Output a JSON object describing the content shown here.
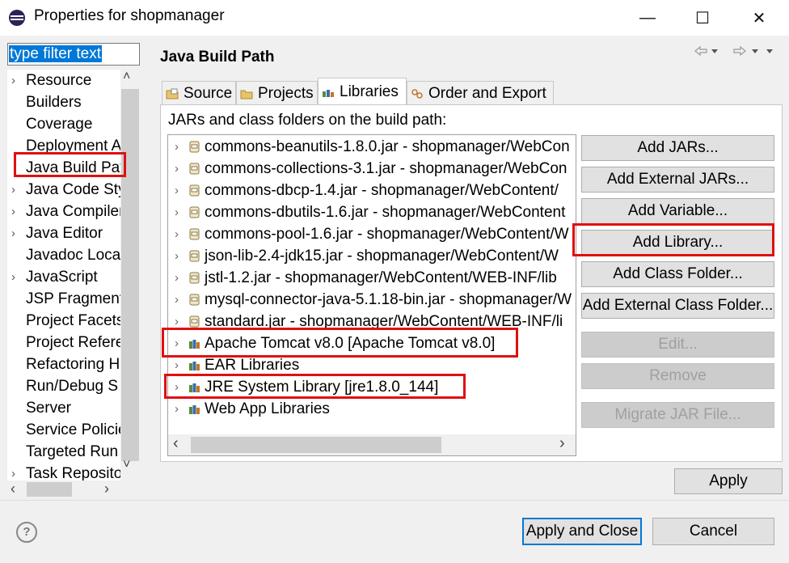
{
  "window": {
    "title": "Properties for shopmanager",
    "minimize_glyph": "—",
    "maximize_glyph": "☐",
    "close_glyph": "✕"
  },
  "filter": {
    "text": "type filter text"
  },
  "sidebar": {
    "items": [
      {
        "label": "Resource",
        "arrow": "›"
      },
      {
        "label": "Builders",
        "arrow": ""
      },
      {
        "label": "Coverage",
        "arrow": ""
      },
      {
        "label": "Deployment A",
        "arrow": ""
      },
      {
        "label": "Java Build Pat",
        "arrow": ""
      },
      {
        "label": "Java Code Sty",
        "arrow": "›"
      },
      {
        "label": "Java Compiler",
        "arrow": "›"
      },
      {
        "label": "Java Editor",
        "arrow": "›"
      },
      {
        "label": "Javadoc Locat",
        "arrow": ""
      },
      {
        "label": "JavaScript",
        "arrow": "›"
      },
      {
        "label": "JSP Fragment",
        "arrow": ""
      },
      {
        "label": "Project Facets",
        "arrow": ""
      },
      {
        "label": "Project Refere",
        "arrow": ""
      },
      {
        "label": "Refactoring H",
        "arrow": ""
      },
      {
        "label": "Run/Debug S",
        "arrow": ""
      },
      {
        "label": "Server",
        "arrow": ""
      },
      {
        "label": "Service Policie",
        "arrow": ""
      },
      {
        "label": "Targeted Run",
        "arrow": ""
      },
      {
        "label": "Task Reposito",
        "arrow": "›"
      }
    ]
  },
  "page": {
    "title": "Java Build Path"
  },
  "tabs": [
    {
      "label": "Source"
    },
    {
      "label": "Projects"
    },
    {
      "label": "Libraries"
    },
    {
      "label": "Order and Export"
    }
  ],
  "panel": {
    "label": "JARs and class folders on the build path:"
  },
  "entries": [
    {
      "label": "commons-beanutils-1.8.0.jar - shopmanager/WebCon",
      "kind": "jar"
    },
    {
      "label": "commons-collections-3.1.jar - shopmanager/WebCon",
      "kind": "jar"
    },
    {
      "label": "commons-dbcp-1.4.jar - shopmanager/WebContent/",
      "kind": "jar"
    },
    {
      "label": "commons-dbutils-1.6.jar - shopmanager/WebContent",
      "kind": "jar"
    },
    {
      "label": "commons-pool-1.6.jar - shopmanager/WebContent/W",
      "kind": "jar"
    },
    {
      "label": "json-lib-2.4-jdk15.jar - shopmanager/WebContent/W",
      "kind": "jar"
    },
    {
      "label": "jstl-1.2.jar - shopmanager/WebContent/WEB-INF/lib",
      "kind": "jar"
    },
    {
      "label": "mysql-connector-java-5.1.18-bin.jar - shopmanager/W",
      "kind": "jar"
    },
    {
      "label": "standard.jar - shopmanager/WebContent/WEB-INF/li",
      "kind": "jar"
    },
    {
      "label": "Apache Tomcat v8.0 [Apache Tomcat v8.0]",
      "kind": "lib"
    },
    {
      "label": "EAR Libraries",
      "kind": "lib"
    },
    {
      "label": "JRE System Library [jre1.8.0_144]",
      "kind": "lib"
    },
    {
      "label": "Web App Libraries",
      "kind": "lib"
    }
  ],
  "buttons": {
    "add_jars": "Add JARs...",
    "add_external_jars": "Add External JARs...",
    "add_variable": "Add Variable...",
    "add_library": "Add Library...",
    "add_class_folder": "Add Class Folder...",
    "add_external_class_folder": "Add External Class Folder...",
    "edit": "Edit...",
    "remove": "Remove",
    "migrate_jar": "Migrate JAR File...",
    "apply": "Apply",
    "apply_and_close": "Apply and Close",
    "cancel": "Cancel"
  },
  "icons": {
    "arrow_right": "›",
    "scroll_up": "˄",
    "scroll_down": "˅",
    "scroll_left": "‹",
    "scroll_right": "›",
    "help": "?"
  },
  "colors": {
    "highlight": "#e01010",
    "selection": "#0078d7"
  }
}
